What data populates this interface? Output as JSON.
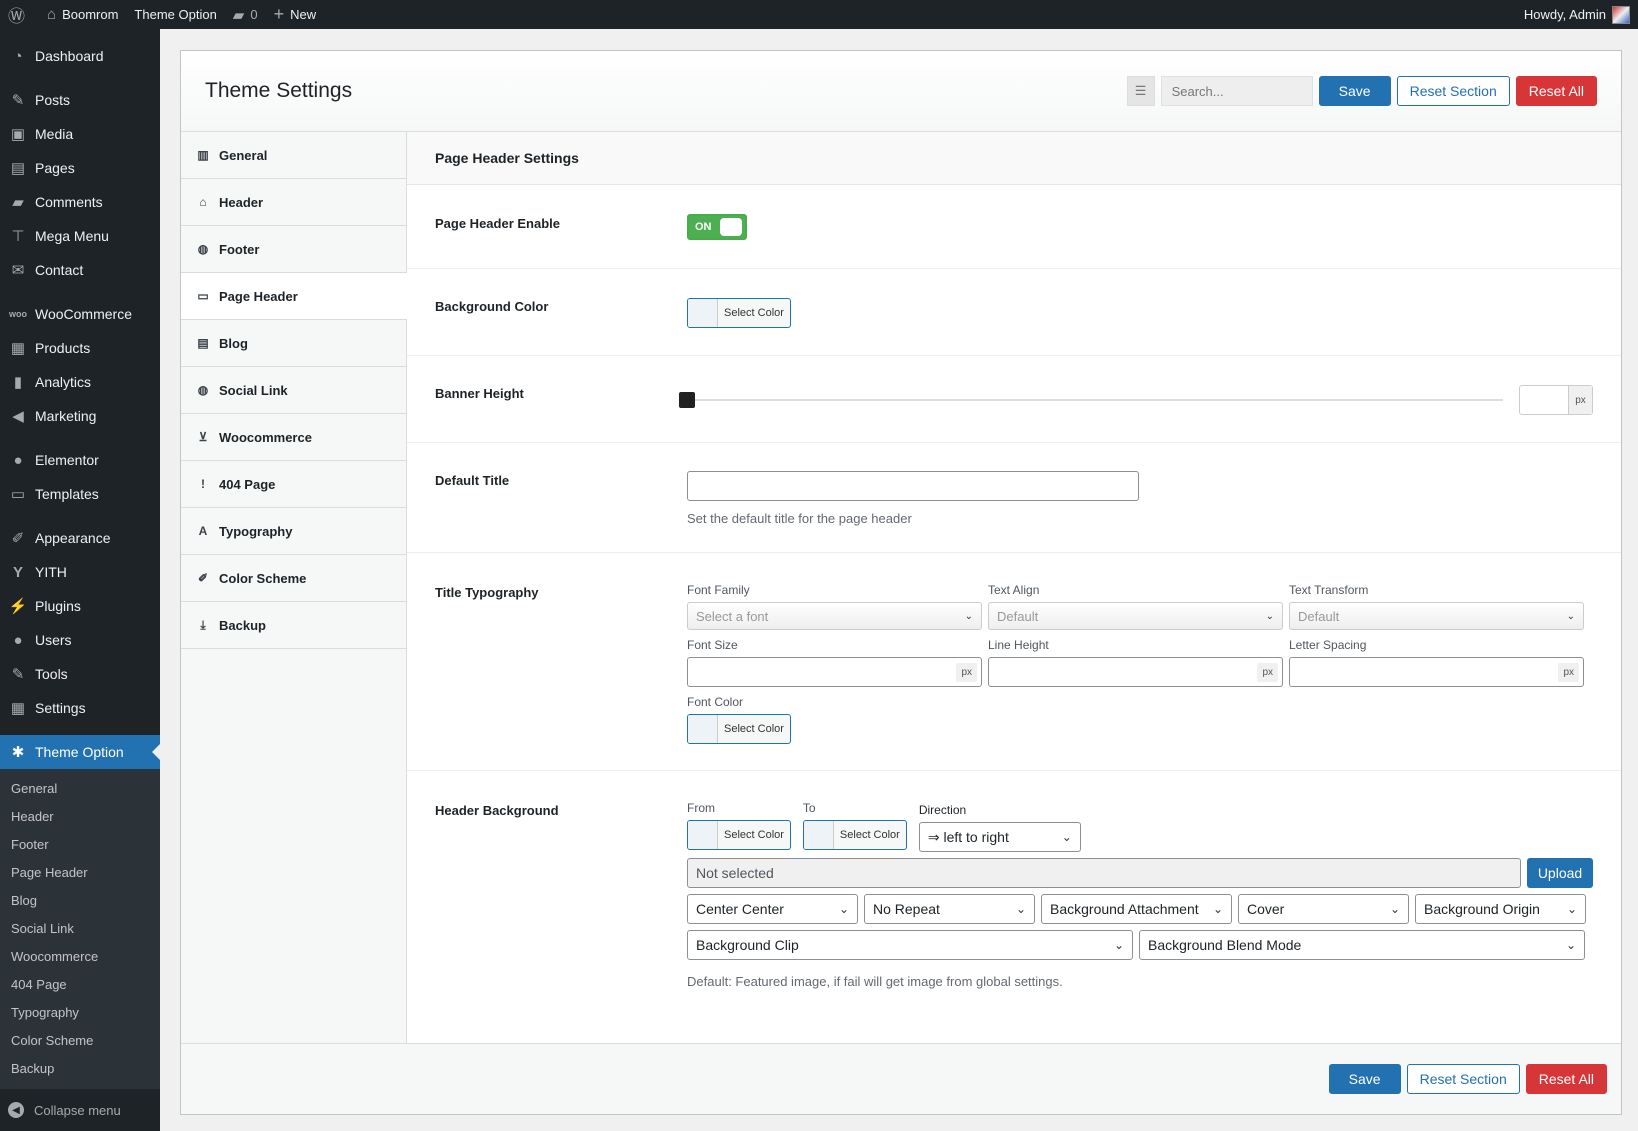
{
  "adminbar": {
    "site_name": "Boomrom",
    "theme_option": "Theme Option",
    "comments_count": "0",
    "new_label": "New",
    "howdy": "Howdy, Admin"
  },
  "sidebar": {
    "items": [
      {
        "label": "Dashboard",
        "icon": "dashboard-icon"
      },
      {
        "label": "Posts",
        "icon": "pin-icon"
      },
      {
        "label": "Media",
        "icon": "media-icon"
      },
      {
        "label": "Pages",
        "icon": "pages-icon"
      },
      {
        "label": "Comments",
        "icon": "comments-icon"
      },
      {
        "label": "Mega Menu",
        "icon": "megamenu-icon"
      },
      {
        "label": "Contact",
        "icon": "mail-icon"
      },
      {
        "label": "WooCommerce",
        "icon": "woo-icon"
      },
      {
        "label": "Products",
        "icon": "products-icon"
      },
      {
        "label": "Analytics",
        "icon": "analytics-icon"
      },
      {
        "label": "Marketing",
        "icon": "megaphone-icon"
      },
      {
        "label": "Elementor",
        "icon": "elementor-icon"
      },
      {
        "label": "Templates",
        "icon": "folder-icon"
      },
      {
        "label": "Appearance",
        "icon": "brush-icon"
      },
      {
        "label": "YITH",
        "icon": "yith-icon"
      },
      {
        "label": "Plugins",
        "icon": "plugin-icon"
      },
      {
        "label": "Users",
        "icon": "users-icon"
      },
      {
        "label": "Tools",
        "icon": "wrench-icon"
      },
      {
        "label": "Settings",
        "icon": "settings-icon"
      },
      {
        "label": "Theme Option",
        "icon": "gear-icon"
      }
    ],
    "submenu": [
      "General",
      "Header",
      "Footer",
      "Page Header",
      "Blog",
      "Social Link",
      "Woocommerce",
      "404 Page",
      "Typography",
      "Color Scheme",
      "Backup"
    ],
    "collapse": "Collapse menu"
  },
  "panel": {
    "title": "Theme Settings",
    "search_placeholder": "Search...",
    "save": "Save",
    "reset_section": "Reset Section",
    "reset_all": "Reset All"
  },
  "nav": [
    "General",
    "Header",
    "Footer",
    "Page Header",
    "Blog",
    "Social Link",
    "Woocommerce",
    "404 Page",
    "Typography",
    "Color Scheme",
    "Backup"
  ],
  "section": {
    "title": "Page Header Settings",
    "page_header_enable": {
      "label": "Page Header Enable",
      "toggle": "ON"
    },
    "background_color": {
      "label": "Background Color",
      "button": "Select Color"
    },
    "banner_height": {
      "label": "Banner Height",
      "unit": "px",
      "value": 0
    },
    "default_title": {
      "label": "Default Title",
      "value": "",
      "desc": "Set the default title for the page header"
    },
    "title_typography": {
      "label": "Title Typography",
      "font_family": {
        "label": "Font Family",
        "value": "Select a font"
      },
      "text_align": {
        "label": "Text Align",
        "value": "Default"
      },
      "text_transform": {
        "label": "Text Transform",
        "value": "Default"
      },
      "font_size": {
        "label": "Font Size",
        "unit": "px"
      },
      "line_height": {
        "label": "Line Height",
        "unit": "px"
      },
      "letter_spacing": {
        "label": "Letter Spacing",
        "unit": "px"
      },
      "font_color": {
        "label": "Font Color",
        "button": "Select Color"
      }
    },
    "header_background": {
      "label": "Header Background",
      "from": "From",
      "to": "To",
      "direction": "Direction",
      "select_color": "Select Color",
      "direction_value": "⇒ left to right",
      "not_selected": "Not selected",
      "upload": "Upload",
      "position": "Center Center",
      "repeat": "No Repeat",
      "attachment": "Background Attachment",
      "size": "Cover",
      "origin": "Background Origin",
      "clip": "Background Clip",
      "blend": "Background Blend Mode",
      "desc": "Default: Featured image, if fail will get image from global settings."
    }
  },
  "colors": {
    "primary": "#2271b1",
    "danger": "#d63638",
    "toggle_on": "#4caf50",
    "admin_dark": "#1d2327"
  }
}
